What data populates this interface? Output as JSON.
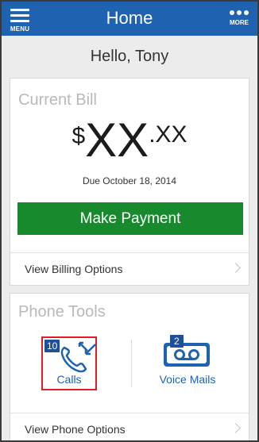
{
  "header": {
    "title": "Home",
    "menu_label": "MENU",
    "more_label": "MORE"
  },
  "greeting": "Hello, Tony",
  "bill": {
    "title": "Current Bill",
    "currency": "$",
    "amount_major": "XX",
    "amount_minor": ".XX",
    "due_text": "Due October 18, 2014",
    "pay_button": "Make Payment",
    "options_link": "View Billing Options"
  },
  "tools": {
    "title": "Phone Tools",
    "calls": {
      "label": "Calls",
      "badge": "10"
    },
    "voicemails": {
      "label": "Voice Mails",
      "badge": "2"
    },
    "options_link": "View Phone Options"
  },
  "colors": {
    "header_bg": "#1f62b0",
    "pay_button_bg": "#168a2c",
    "highlight_border": "#e31b23"
  }
}
